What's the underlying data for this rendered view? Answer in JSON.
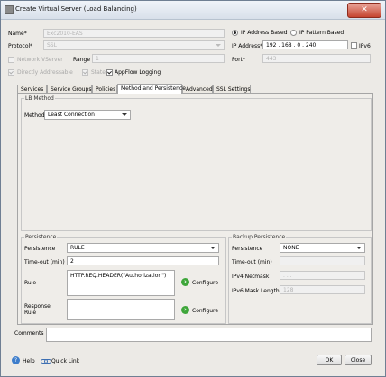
{
  "window": {
    "title": "Create Virtual Server (Load Balancing)",
    "close_glyph": "✕"
  },
  "form": {
    "name_label": "Name*",
    "name_value": "Exc2010-EAS",
    "protocol_label": "Protocol*",
    "protocol_value": "SSL",
    "network_vserver_label": "Network VServer",
    "network_vserver_checked": false,
    "range_label": "Range",
    "range_value": "1",
    "directly_addressable_label": "Directly Addressable",
    "directly_addressable_checked": true,
    "state_label": "State",
    "state_checked": true,
    "appflow_label": "AppFlow Logging",
    "appflow_checked": true,
    "ip_based_label": "IP Address Based",
    "ip_based_selected": true,
    "ip_pattern_label": "IP Pattern Based",
    "ip_pattern_selected": false,
    "ip_address_label": "IP Address*",
    "ip_address_value": "192 . 168 . 0 . 240",
    "ipv6_label": "IPv6",
    "ipv6_checked": false,
    "port_label": "Port*",
    "port_value": "443"
  },
  "tabs": [
    {
      "label": "Services",
      "active": false
    },
    {
      "label": "Service Groups",
      "active": false
    },
    {
      "label": "Policies",
      "active": false
    },
    {
      "label": "Method and Persistence",
      "active": true
    },
    {
      "label": "Advanced",
      "active": false
    },
    {
      "label": "SSL Settings",
      "active": false
    }
  ],
  "lb_method": {
    "group_title": "LB Method",
    "method_label": "Method",
    "method_value": "Least Connection"
  },
  "persistence": {
    "group_title": "Persistence",
    "persistence_label": "Persistence",
    "persistence_value": "RULE",
    "timeout_label": "Time-out (min)",
    "timeout_value": "2",
    "rule_label": "Rule",
    "rule_value": "HTTP.REQ.HEADER(\"Authorization\")",
    "configure_label": "Configure",
    "response_rule_label": "Response\nRule",
    "response_rule_value": "",
    "configure2_label": "Configure"
  },
  "backup_persistence": {
    "group_title": "Backup Persistence",
    "persistence_label": "Persistence",
    "persistence_value": "NONE",
    "timeout_label": "Time-out (min)",
    "timeout_value": "",
    "ipv4_netmask_label": "IPv4 Netmask",
    "ipv4_netmask_value": ".       .       .",
    "ipv6_mask_label": "IPv6 Mask Length",
    "ipv6_mask_value": "128"
  },
  "comments": {
    "label": "Comments",
    "value": ""
  },
  "footer": {
    "help_label": "Help",
    "quick_link_label": "Quick Link",
    "ok_label": "OK",
    "close_label": "Close"
  }
}
